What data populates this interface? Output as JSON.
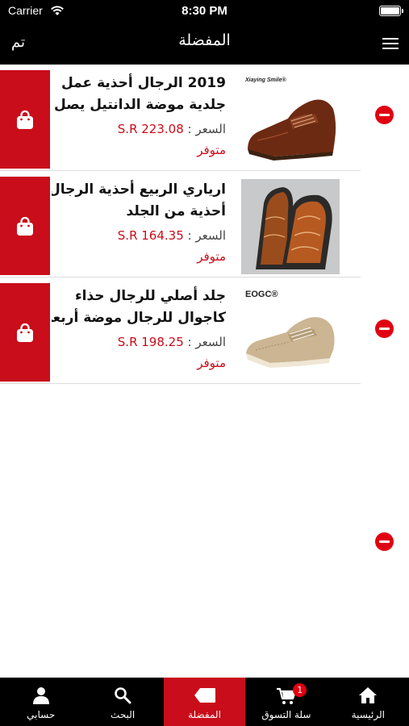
{
  "status_bar": {
    "carrier": "Carrier",
    "time": "8:30 PM"
  },
  "nav": {
    "title": "المفضلة",
    "done_label": "تم"
  },
  "favorites": [
    {
      "title_line1": "2019 الرجال أحذية عمل",
      "title_line2": "جلدية موضة الدانتيل يصل",
      "price_label": "السعر :",
      "price": "S.R 223.08",
      "stock": "متوفر",
      "image_text": "Xiaying Smile®"
    },
    {
      "title_line1": "ارياري الربيع أحذية الرجال",
      "title_line2": "أحذية من الجلد",
      "price_label": "السعر :",
      "price": "S.R 164.35",
      "stock": "متوفر",
      "image_text": ""
    },
    {
      "title_line1": "جلد أصلي للرجال حذاء",
      "title_line2": "كاجوال للرجال موضة أربعة",
      "price_label": "السعر :",
      "price": "S.R 198.25",
      "stock": "متوفر",
      "image_text": "EOGC®"
    }
  ],
  "tabs": [
    {
      "label": "حسابي",
      "icon": "person-icon"
    },
    {
      "label": "البحث",
      "icon": "search-icon"
    },
    {
      "label": "المفضلة",
      "icon": "favorites-tag-icon",
      "active": true
    },
    {
      "label": "سلة التسوق",
      "icon": "cart-icon",
      "badge": "1"
    },
    {
      "label": "الرئيسية",
      "icon": "home-icon"
    }
  ],
  "colors": {
    "accent": "#c90d1a",
    "bars": "#000000",
    "remove": "#e00012"
  }
}
